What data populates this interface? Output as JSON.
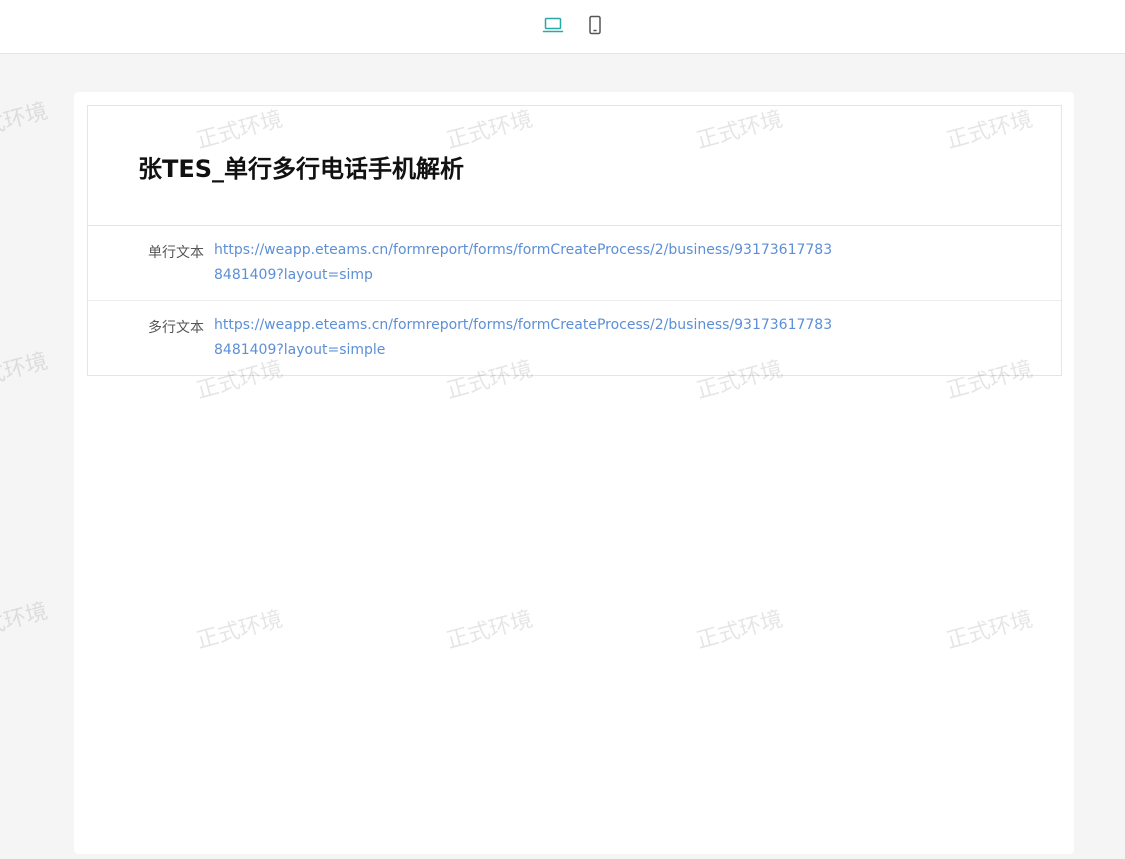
{
  "toolbar": {
    "desktop_icon": "laptop-icon",
    "mobile_icon": "mobile-icon",
    "active_color": "#29a8a8",
    "inactive_color": "#555555"
  },
  "watermark": {
    "text": "正式环境"
  },
  "form": {
    "title": "张TES_单行多行电话手机解析",
    "fields": [
      {
        "label": "单行文本",
        "value": "https://weapp.eteams.cn/formreport/forms/formCreateProcess/2/business/931736177838481409?layout=simp"
      },
      {
        "label": "多行文本",
        "value": "https://weapp.eteams.cn/formreport/forms/formCreateProcess/2/business/931736177838481409?layout=simple"
      }
    ],
    "link_color": "#5c8fd6"
  }
}
